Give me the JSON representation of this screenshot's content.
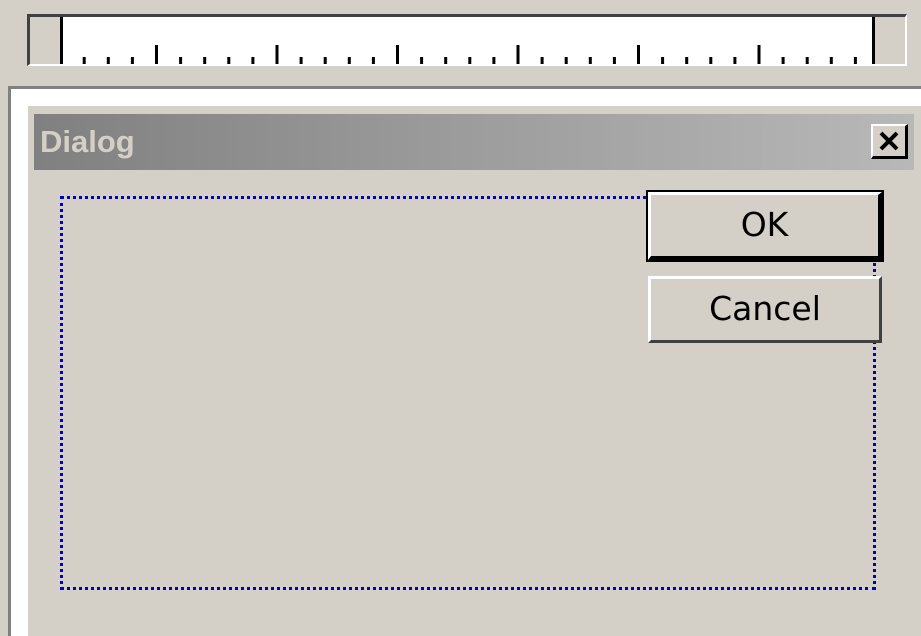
{
  "dialog": {
    "title": "Dialog",
    "close_icon": "close-icon",
    "ok_label": "OK",
    "cancel_label": "Cancel"
  },
  "colors": {
    "face": "#d4d0c8",
    "title_gradient_start": "#808080",
    "title_gradient_end": "#b8b8b8",
    "selection_dots": "#0000c8"
  }
}
